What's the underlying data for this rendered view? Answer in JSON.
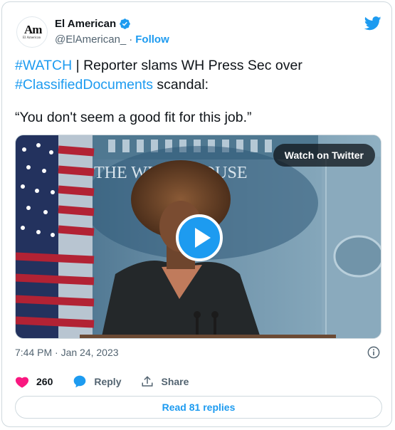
{
  "author": {
    "name": "El American",
    "handle": "@ElAmerican_",
    "separator": "·",
    "follow_label": "Follow",
    "avatar_text": "Am",
    "avatar_subtext": "El American"
  },
  "tweet": {
    "hashtag_watch": "#WATCH",
    "text_part1": " | Reporter slams WH Press Sec over ",
    "hashtag_docs": "#ClassifiedDocuments",
    "text_part2": " scandal:",
    "quote": "“You don't seem a good fit for this job.”"
  },
  "media": {
    "watch_label": "Watch on Twitter",
    "sign_text": "THE WHITE HOUSE"
  },
  "timestamp": "7:44 PM · Jan 24, 2023",
  "actions": {
    "like_count": "260",
    "reply_label": "Reply",
    "share_label": "Share"
  },
  "read_replies_label": "Read 81 replies",
  "colors": {
    "accent": "#1d9bf0",
    "like": "#f91880",
    "muted": "#536471"
  }
}
